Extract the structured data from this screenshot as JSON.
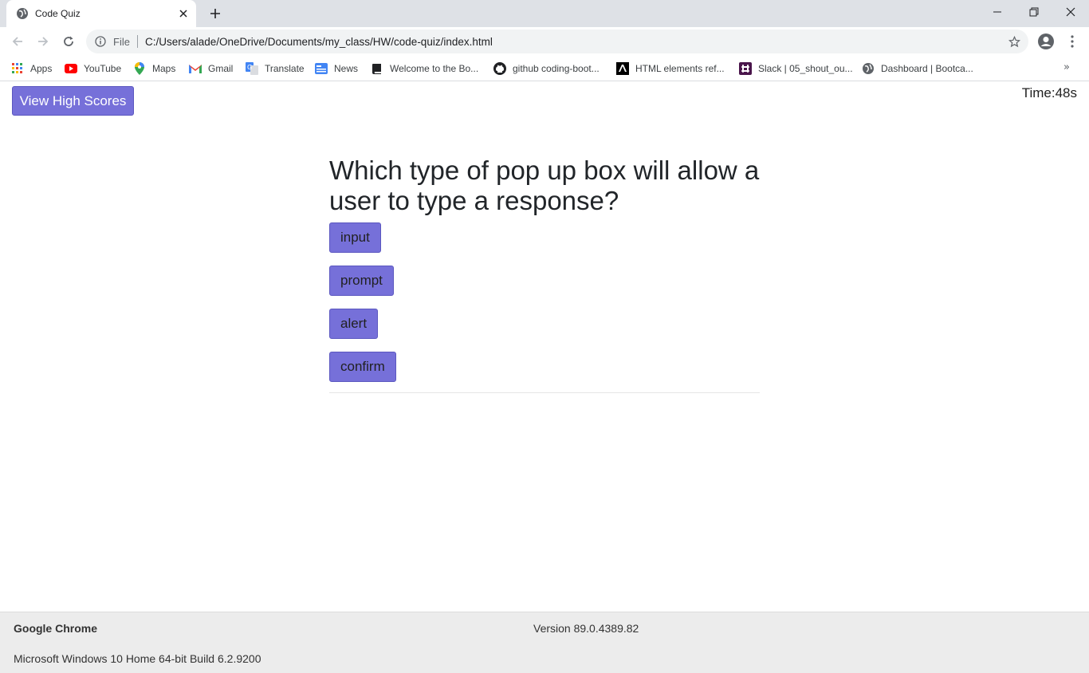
{
  "browser": {
    "tab_title": "Code Quiz",
    "omnibox_scheme": "File",
    "url": "C:/Users/alade/OneDrive/Documents/my_class/HW/code-quiz/index.html",
    "bookmarks": [
      {
        "label": "Apps",
        "icon": "apps-grid-icon"
      },
      {
        "label": "YouTube",
        "icon": "youtube-icon"
      },
      {
        "label": "Maps",
        "icon": "maps-pin-icon"
      },
      {
        "label": "Gmail",
        "icon": "gmail-icon"
      },
      {
        "label": "Translate",
        "icon": "translate-icon"
      },
      {
        "label": "News",
        "icon": "news-icon"
      },
      {
        "label": "Welcome to the Bo...",
        "icon": "book-icon"
      },
      {
        "label": "github coding-boot...",
        "icon": "github-icon"
      },
      {
        "label": "HTML elements ref...",
        "icon": "mdn-icon"
      },
      {
        "label": "Slack | 05_shout_ou...",
        "icon": "slack-icon"
      },
      {
        "label": "Dashboard | Bootca...",
        "icon": "globe-icon"
      }
    ],
    "more_bookmarks": "»"
  },
  "page": {
    "high_scores_label": "View High Scores",
    "timer": "Time:48s",
    "question": "Which type of pop up box will allow a user to type a response?",
    "answers": [
      "input",
      "prompt",
      "alert",
      "confirm"
    ]
  },
  "footer": {
    "app_name": "Google Chrome",
    "version": "Version 89.0.4389.82",
    "os": "Microsoft Windows 10 Home 64-bit Build 6.2.9200"
  },
  "colors": {
    "button": "#7670d9",
    "titlebar": "#dee1e6",
    "omnibox": "#f1f3f4",
    "footer": "#ececec"
  }
}
